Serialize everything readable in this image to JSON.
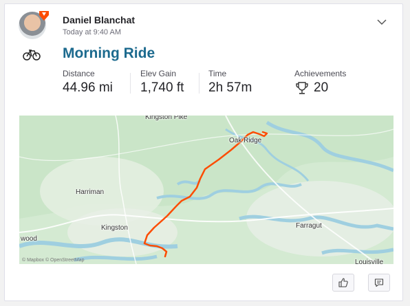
{
  "athlete": {
    "name": "Daniel Blanchat",
    "timestamp": "Today at 9:40 AM"
  },
  "activity": {
    "type_icon": "bike-icon",
    "title": "Morning Ride"
  },
  "stats": [
    {
      "label": "Distance",
      "value": "44.96 mi"
    },
    {
      "label": "Elev Gain",
      "value": "1,740 ft"
    },
    {
      "label": "Time",
      "value": "2h 57m"
    },
    {
      "label": "Achievements",
      "value": "20",
      "icon": "trophy-icon"
    }
  ],
  "map": {
    "labels": {
      "oak_ridge": "Oak Ridge",
      "harriman": "Harriman",
      "kingston": "Kingston",
      "farragut": "Farragut",
      "wood": "wood",
      "louisville": "Louisville",
      "top_partial": "Kingston Pike"
    },
    "attribution": "© Mapbox © OpenStreetMap",
    "route_color": "#fc4c02"
  },
  "actions": {
    "kudos_icon": "thumbs-up-icon",
    "comment_icon": "comment-icon"
  },
  "colors": {
    "title": "#1c6a8e",
    "brand": "#fc4c02"
  }
}
